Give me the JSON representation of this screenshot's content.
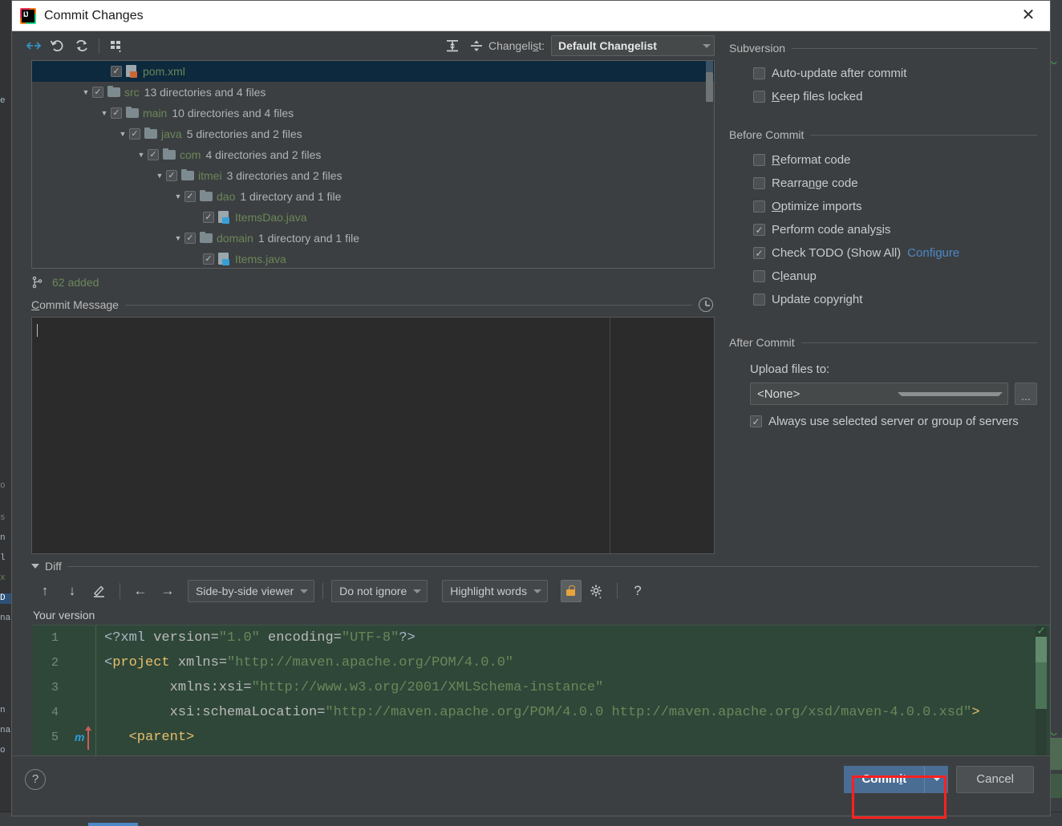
{
  "window": {
    "title": "Commit Changes",
    "logo_icon": "intellij-idea-logo",
    "close_icon": "close-icon"
  },
  "toolbar": {
    "buttons": [
      {
        "name": "collapse-selection-icon",
        "glyph": "⇥"
      },
      {
        "name": "rollback-icon",
        "glyph": "↺"
      },
      {
        "name": "refresh-icon",
        "glyph": "⟳"
      },
      {
        "name": "group-by-icon",
        "glyph": "▦"
      }
    ],
    "expand_all_icon": "expand-all-icon",
    "collapse_all_icon": "collapse-all-icon",
    "changelist_label": "Changelist:",
    "changelist_mnemonic": "s",
    "changelist_value": "Default Changelist"
  },
  "tree": {
    "rows": [
      {
        "indent": 4,
        "twisty": "",
        "checked": true,
        "icon": "xml-file-icon",
        "name": "pom.xml",
        "meta": "",
        "selected": true
      },
      {
        "indent": 3,
        "twisty": "▼",
        "checked": true,
        "icon": "folder-icon",
        "name": "src",
        "meta": "13 directories and 4 files",
        "selected": false
      },
      {
        "indent": 4,
        "twisty": "▼",
        "checked": true,
        "icon": "folder-icon",
        "name": "main",
        "meta": "10 directories and 4 files",
        "selected": false
      },
      {
        "indent": 5,
        "twisty": "▼",
        "checked": true,
        "icon": "folder-icon",
        "name": "java",
        "meta": "5 directories and 2 files",
        "selected": false
      },
      {
        "indent": 6,
        "twisty": "▼",
        "checked": true,
        "icon": "folder-icon",
        "name": "com",
        "meta": "4 directories and 2 files",
        "selected": false
      },
      {
        "indent": 7,
        "twisty": "▼",
        "checked": true,
        "icon": "folder-icon",
        "name": "itmei",
        "meta": "3 directories and 2 files",
        "selected": false
      },
      {
        "indent": 8,
        "twisty": "▼",
        "checked": true,
        "icon": "folder-icon",
        "name": "dao",
        "meta": "1 directory and 1 file",
        "selected": false
      },
      {
        "indent": 9,
        "twisty": "",
        "checked": true,
        "icon": "java-file-icon",
        "name": "ItemsDao.java",
        "meta": "",
        "selected": false
      },
      {
        "indent": 8,
        "twisty": "▼",
        "checked": true,
        "icon": "folder-icon",
        "name": "domain",
        "meta": "1 directory and 1 file",
        "selected": false
      },
      {
        "indent": 9,
        "twisty": "",
        "checked": true,
        "icon": "java-file-icon",
        "name": "Items.java",
        "meta": "",
        "selected": false
      }
    ],
    "status_icon": "branch-icon",
    "status_text": "62 added"
  },
  "commit_message": {
    "label": "Commit Message",
    "mnemonic": "C",
    "history_icon": "history-clock-icon",
    "value": "",
    "placeholder": ""
  },
  "options": {
    "subversion": {
      "title": "Subversion",
      "items": [
        {
          "label": "Auto-update after commit",
          "mnemonic": "",
          "checked": false,
          "name": "auto-update-after-commit-checkbox"
        },
        {
          "label": "Keep files locked",
          "mnemonic": "K",
          "checked": false,
          "name": "keep-files-locked-checkbox"
        }
      ]
    },
    "before_commit": {
      "title": "Before Commit",
      "items": [
        {
          "label": "Reformat code",
          "mnemonic": "R",
          "checked": false,
          "name": "reformat-code-checkbox"
        },
        {
          "label": "Rearrange code",
          "mnemonic": "n",
          "checked": false,
          "name": "rearrange-code-checkbox"
        },
        {
          "label": "Optimize imports",
          "mnemonic": "O",
          "checked": false,
          "name": "optimize-imports-checkbox"
        },
        {
          "label": "Perform code analysis",
          "mnemonic": "s",
          "checked": true,
          "name": "perform-code-analysis-checkbox"
        },
        {
          "label": "Check TODO (Show All)",
          "mnemonic": "",
          "checked": true,
          "name": "check-todo-checkbox",
          "link": "Configure"
        },
        {
          "label": "Cleanup",
          "mnemonic": "l",
          "checked": false,
          "name": "cleanup-checkbox"
        },
        {
          "label": "Update copyright",
          "mnemonic": "",
          "checked": false,
          "name": "update-copyright-checkbox"
        }
      ]
    },
    "after_commit": {
      "title": "After Commit",
      "upload_label": "Upload files to:",
      "upload_value": "<None>",
      "browse_label": "...",
      "always_use": {
        "label": "Always use selected server or group of servers",
        "checked": true
      }
    }
  },
  "diff": {
    "section_label": "Diff",
    "buttons": [
      {
        "name": "previous-difference-icon",
        "glyph": "↑"
      },
      {
        "name": "next-difference-icon",
        "glyph": "↓"
      },
      {
        "name": "edit-source-icon",
        "glyph": "✎"
      },
      {
        "name": "accept-left-icon",
        "glyph": "←"
      },
      {
        "name": "accept-right-icon",
        "glyph": "→"
      }
    ],
    "viewer_mode": "Side-by-side viewer",
    "ignore_mode": "Do not ignore",
    "highlight_mode": "Highlight words",
    "lock_icon": "read-only-lock-icon",
    "settings_icon": "gear-icon",
    "help_icon": "question-mark-icon",
    "pane_title": "Your version",
    "code_lines": [
      {
        "num": "1",
        "marker": "",
        "parts": [
          {
            "t": "punct",
            "v": "<?xml "
          },
          {
            "t": "attr",
            "v": "version="
          },
          {
            "t": "str",
            "v": "\"1.0\""
          },
          {
            "t": "attr",
            "v": " encoding="
          },
          {
            "t": "str",
            "v": "\"UTF-8\""
          },
          {
            "t": "punct",
            "v": "?>"
          }
        ]
      },
      {
        "num": "2",
        "marker": "",
        "parts": [
          {
            "t": "punct",
            "v": "<"
          },
          {
            "t": "tag",
            "v": "project"
          },
          {
            "t": "attr",
            "v": " xmlns="
          },
          {
            "t": "str",
            "v": "\"http://maven.apache.org/POM/4.0.0\""
          }
        ]
      },
      {
        "num": "3",
        "marker": "",
        "parts": [
          {
            "t": "attr",
            "v": "        xmlns:xsi="
          },
          {
            "t": "str",
            "v": "\"http://www.w3.org/2001/XMLSchema-instance\""
          }
        ]
      },
      {
        "num": "4",
        "marker": "",
        "parts": [
          {
            "t": "attr",
            "v": "        xsi:schemaLocation="
          },
          {
            "t": "str",
            "v": "\"http://maven.apache.org/POM/4.0.0 http://maven.apache.org/xsd/maven-4.0.0.xsd\""
          },
          {
            "t": "tag",
            "v": ">"
          }
        ]
      },
      {
        "num": "5",
        "marker": "m",
        "parts": [
          {
            "t": "tag",
            "v": "   <parent>"
          }
        ]
      }
    ]
  },
  "footer": {
    "help_label": "?",
    "commit_label": "Commit",
    "commit_mnemonic": "i",
    "commit_dropdown_icon": "chevron-down-icon",
    "cancel_label": "Cancel"
  },
  "colors": {
    "accent": "#4a88c7",
    "commit_button": "#4a6d94",
    "added_green": "#6a8759",
    "highlight_red": "#ff2020",
    "dialog_bg": "#3c3f41",
    "tree_selected": "#0d293e"
  }
}
